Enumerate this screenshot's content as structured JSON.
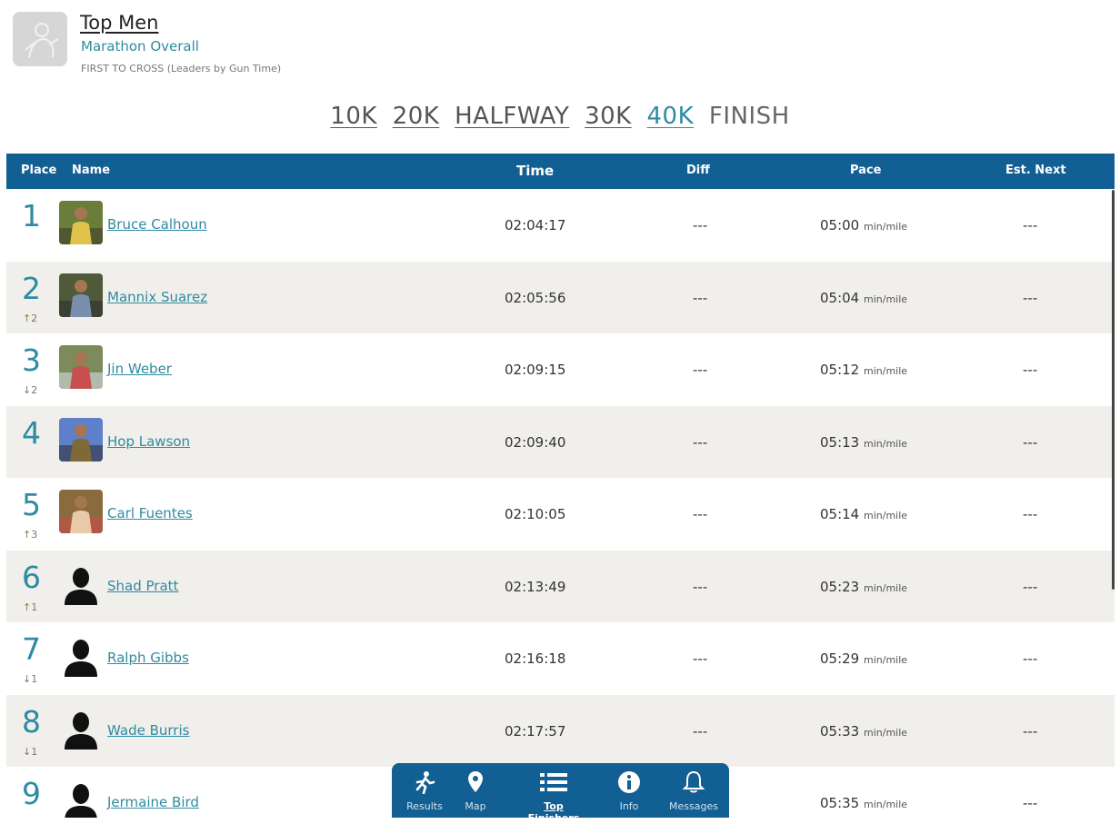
{
  "header": {
    "title": "Top Men",
    "subtitle": "Marathon Overall",
    "note": "FIRST TO CROSS (Leaders by Gun Time)",
    "logo_icon": "runner-silhouette-icon"
  },
  "splits": {
    "items": [
      {
        "label": "10K"
      },
      {
        "label": "20K"
      },
      {
        "label": "HALFWAY"
      },
      {
        "label": "30K"
      },
      {
        "label": "40K",
        "state": "active"
      },
      {
        "label": "FINISH",
        "state": "current"
      }
    ]
  },
  "table": {
    "headers": {
      "place": "Place",
      "name": "Name",
      "time": "Time",
      "diff": "Diff",
      "pace": "Pace",
      "next": "Est. Next"
    },
    "pace_unit": "min/mile",
    "rows": [
      {
        "place": "1",
        "name": "Bruce Calhoun",
        "time": "02:04:17",
        "diff": "---",
        "pace": "05:00",
        "next": "---",
        "move": "",
        "move_dir": "",
        "photo": "photo"
      },
      {
        "place": "2",
        "name": "Mannix Suarez",
        "time": "02:05:56",
        "diff": "---",
        "pace": "05:04",
        "next": "---",
        "move": "2",
        "move_dir": "up",
        "photo": "photo"
      },
      {
        "place": "3",
        "name": "Jin Weber",
        "time": "02:09:15",
        "diff": "---",
        "pace": "05:12",
        "next": "---",
        "move": "2",
        "move_dir": "down",
        "photo": "photo"
      },
      {
        "place": "4",
        "name": "Hop Lawson",
        "time": "02:09:40",
        "diff": "---",
        "pace": "05:13",
        "next": "---",
        "move": "",
        "move_dir": "",
        "photo": "photo"
      },
      {
        "place": "5",
        "name": "Carl Fuentes",
        "time": "02:10:05",
        "diff": "---",
        "pace": "05:14",
        "next": "---",
        "move": "3",
        "move_dir": "up",
        "photo": "photo"
      },
      {
        "place": "6",
        "name": "Shad Pratt",
        "time": "02:13:49",
        "diff": "---",
        "pace": "05:23",
        "next": "---",
        "move": "1",
        "move_dir": "up",
        "photo": "silhouette"
      },
      {
        "place": "7",
        "name": "Ralph Gibbs",
        "time": "02:16:18",
        "diff": "---",
        "pace": "05:29",
        "next": "---",
        "move": "1",
        "move_dir": "down",
        "photo": "silhouette"
      },
      {
        "place": "8",
        "name": "Wade Burris",
        "time": "02:17:57",
        "diff": "---",
        "pace": "05:33",
        "next": "---",
        "move": "1",
        "move_dir": "down",
        "photo": "silhouette"
      },
      {
        "place": "9",
        "name": "Jermaine Bird",
        "time": "",
        "diff": "",
        "pace": "05:35",
        "next": "---",
        "move": "",
        "move_dir": "",
        "photo": "silhouette"
      }
    ]
  },
  "bottom_nav": {
    "items": [
      {
        "label": "Results",
        "icon": "runner-icon"
      },
      {
        "label": "Map",
        "icon": "map-pin-icon"
      },
      {
        "label": "Top Finishers",
        "icon": "list-icon",
        "active": true
      },
      {
        "label": "Info",
        "icon": "info-icon"
      },
      {
        "label": "Messages",
        "icon": "bell-icon"
      }
    ]
  },
  "colors": {
    "accent": "#2f8ba1",
    "header_bar": "#125f93",
    "alt_row": "#f0efeb"
  }
}
